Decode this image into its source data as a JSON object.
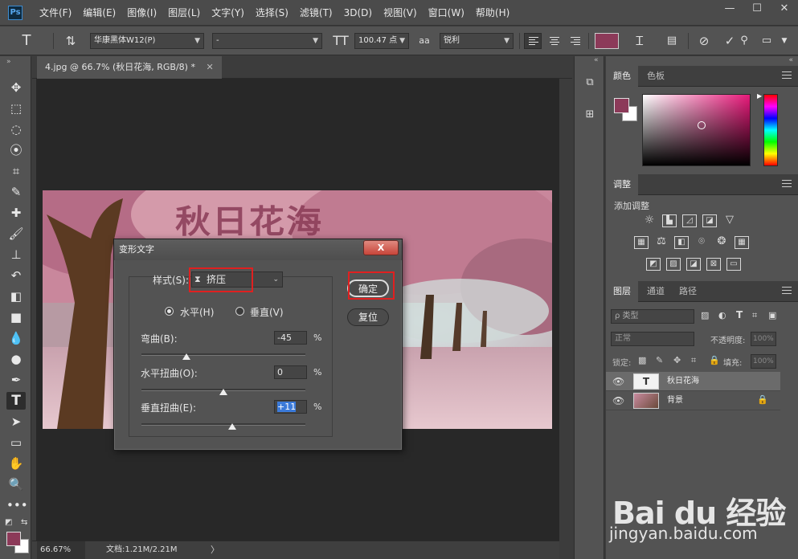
{
  "app": {
    "logo": "Ps"
  },
  "menubar": {
    "items": [
      "文件(F)",
      "编辑(E)",
      "图像(I)",
      "图层(L)",
      "文字(Y)",
      "选择(S)",
      "滤镜(T)",
      "3D(D)",
      "视图(V)",
      "窗口(W)",
      "帮助(H)"
    ],
    "window_controls": {
      "minimize": "—",
      "restore": "☐",
      "close": "✕"
    }
  },
  "options": {
    "tool_glyph": "T",
    "font_family": "华康黑体W12(P)",
    "font_style": "-",
    "font_size": "100.47 点",
    "antialias_glyph": "aa",
    "antialias": "锐利",
    "text_color": "#8c3a59"
  },
  "document": {
    "tab_title": "4.jpg @ 66.7% (秋日花海, RGB/8) *",
    "tab_close": "✕",
    "warped_text": "秋日花海"
  },
  "statusbar": {
    "zoom": "66.67%",
    "doc_size": "文档:1.21M/2.21M",
    "arrow": "〉"
  },
  "color_panel": {
    "tabs": [
      "颜色",
      "色板"
    ],
    "foreground": "#8c3a59",
    "background": "#ffffff"
  },
  "adjust_panel": {
    "tab": "调整",
    "add_label": "添加调整"
  },
  "layers_panel": {
    "tabs": [
      "图层",
      "通道",
      "路径"
    ],
    "filter": "ρ 类型",
    "blend_mode": "正常",
    "opacity_label": "不透明度:",
    "opacity": "100%",
    "lock_label": "锁定:",
    "fill_label": "填充:",
    "fill": "100%",
    "layers": [
      {
        "name": "秋日花海",
        "thumb": "T",
        "selected": true
      },
      {
        "name": "背景",
        "thumb": "",
        "selected": false
      }
    ]
  },
  "warp_dialog": {
    "title": "变形文字",
    "close_label": "X",
    "style_label": "样式(S):",
    "style_value": "挤压",
    "orientation": {
      "horizontal": "水平(H)",
      "vertical": "垂直(V)",
      "selected": "horizontal"
    },
    "bend": {
      "label": "弯曲(B):",
      "value": "-45",
      "unit": "%",
      "percent": -45
    },
    "h_distort": {
      "label": "水平扭曲(O):",
      "value": "0",
      "unit": "%",
      "percent": 0
    },
    "v_distort": {
      "label": "垂直扭曲(E):",
      "value": "+11",
      "unit": "%",
      "percent": 11
    },
    "ok_label": "确定",
    "reset_label": "复位"
  },
  "watermark": {
    "logo": "Bai du 经验",
    "url": "jingyan.baidu.com"
  }
}
